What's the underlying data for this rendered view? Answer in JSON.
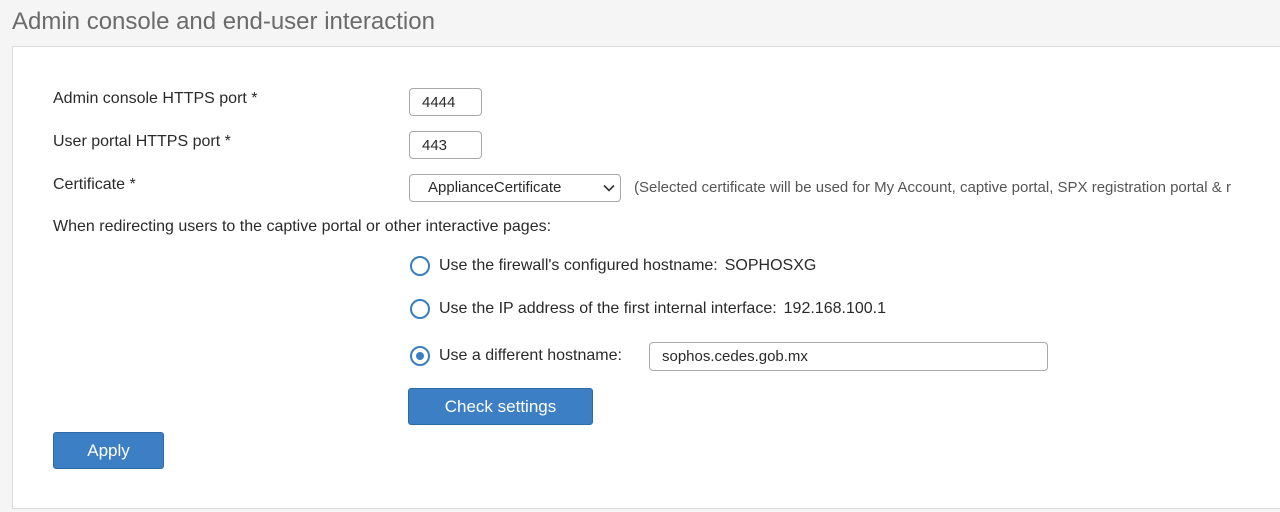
{
  "section": {
    "title": "Admin console and end-user interaction"
  },
  "form": {
    "admin_port": {
      "label": "Admin console HTTPS port *",
      "value": "4444"
    },
    "user_port": {
      "label": "User portal HTTPS port *",
      "value": "443"
    },
    "certificate": {
      "label": "Certificate *",
      "selected": "ApplianceCertificate",
      "hint": "(Selected certificate will be used for My Account, captive portal, SPX registration portal & r"
    },
    "redirect": {
      "label": "When redirecting users to the captive portal or other interactive pages:",
      "options": [
        {
          "label": "Use the firewall's configured hostname:",
          "value": "SOPHOSXG",
          "checked": false
        },
        {
          "label": "Use the IP address of the first internal interface:",
          "value": "192.168.100.1",
          "checked": false
        },
        {
          "label": "Use a different hostname:",
          "value": "sophos.cedes.gob.mx",
          "checked": true
        }
      ]
    },
    "check_settings_label": "Check settings",
    "apply_label": "Apply"
  },
  "colors": {
    "accent": "#3d7fc4",
    "radio": "#3a7ebf",
    "title": "#6b6b6b"
  },
  "icons": {
    "select_chevron": "chevron-down-icon"
  }
}
